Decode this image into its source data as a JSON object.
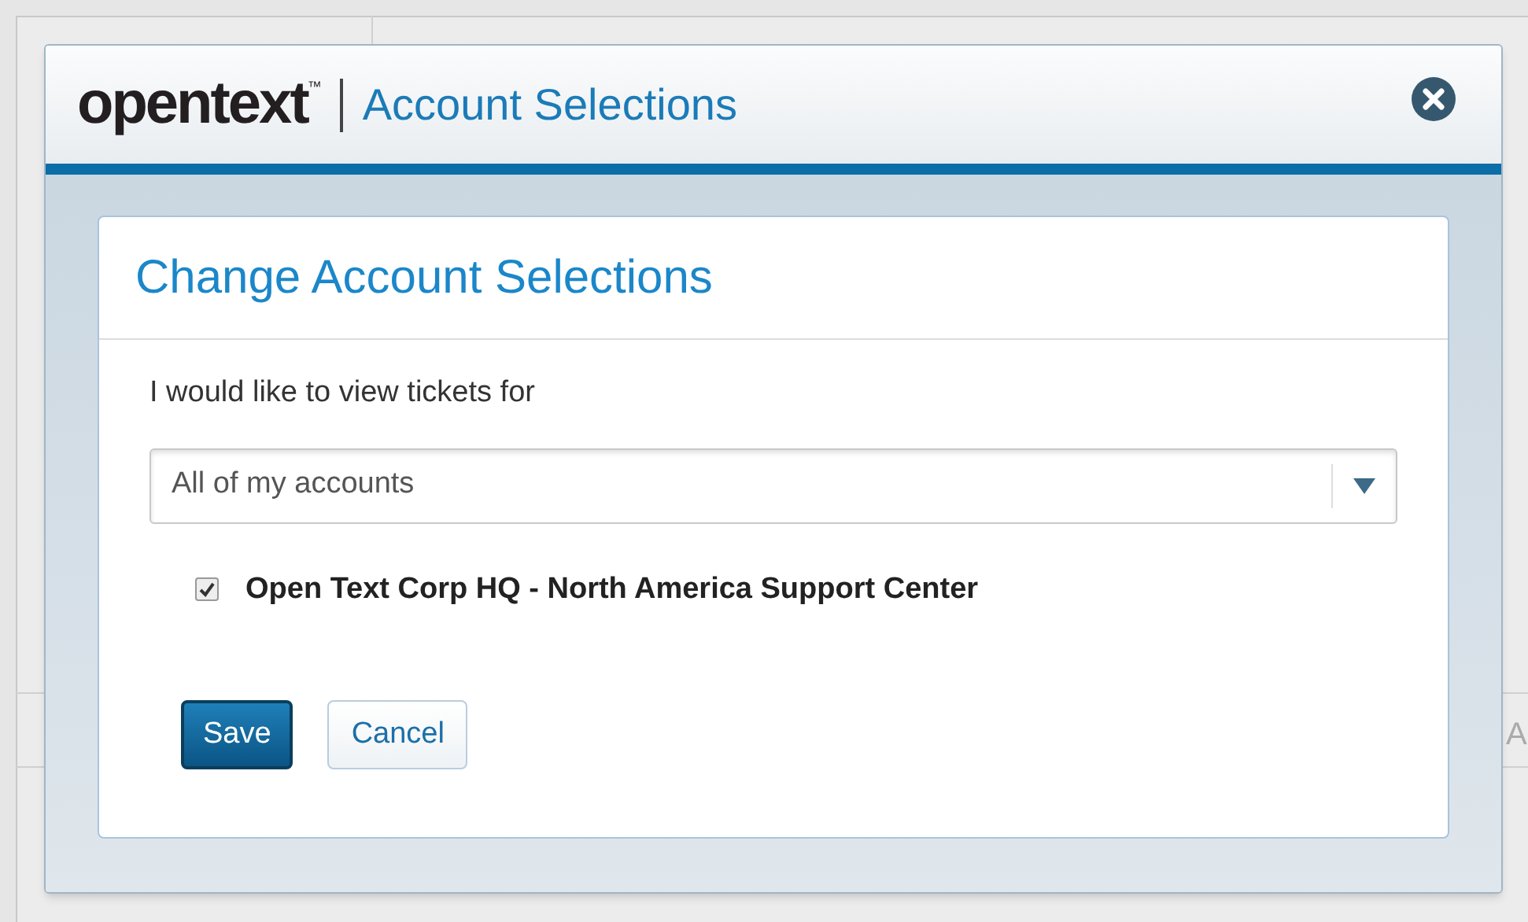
{
  "background": {
    "fragment": "A"
  },
  "dialog": {
    "brand": "opentext",
    "brand_mark": "™",
    "title": "Account Selections",
    "panel": {
      "heading": "Change Account Selections",
      "prompt": "I would like to view tickets for",
      "select": {
        "value": "All of my accounts"
      },
      "accounts": [
        {
          "label": "Open Text Corp HQ - North America Support Center",
          "checked": true
        }
      ],
      "buttons": [
        {
          "label": "Save",
          "kind": "primary"
        },
        {
          "label": "Cancel",
          "kind": "secondary"
        }
      ]
    }
  }
}
